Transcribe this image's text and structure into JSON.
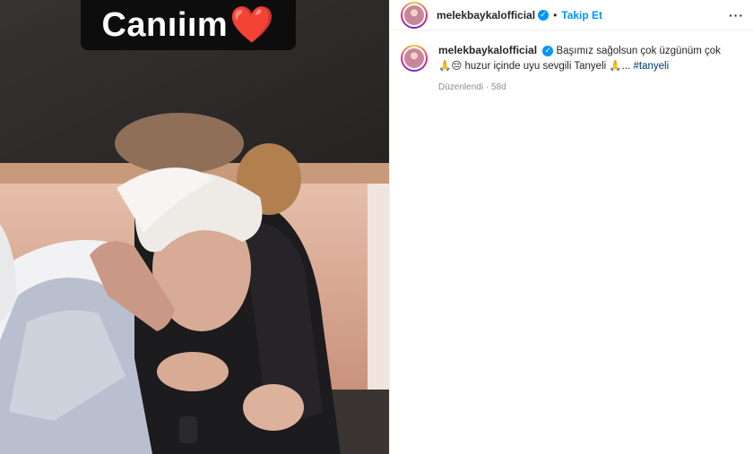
{
  "story": {
    "caption_text": "Canıiım",
    "heart_emoji": "❤️"
  },
  "post": {
    "username": "melekbaykalofficial",
    "verified_icon": "verified-badge-icon",
    "separator": "•",
    "follow_label": "Takip Et",
    "more_label": "···",
    "caption": {
      "text": "Başımız sağolsun çok üzgünüm çok 🙏😔 huzur içinde uyu sevgili Tanyeli 🙏...",
      "hashtag": "#tanyeli"
    },
    "meta": {
      "edited_label": "Düzenlendi",
      "separator": "·",
      "age": "58d"
    }
  },
  "colors": {
    "accent": "#0095f6",
    "hashtag": "#00376b",
    "muted": "#8e8e8e",
    "caption_bg": "#0d0d0d",
    "heart": "#e0202c"
  }
}
